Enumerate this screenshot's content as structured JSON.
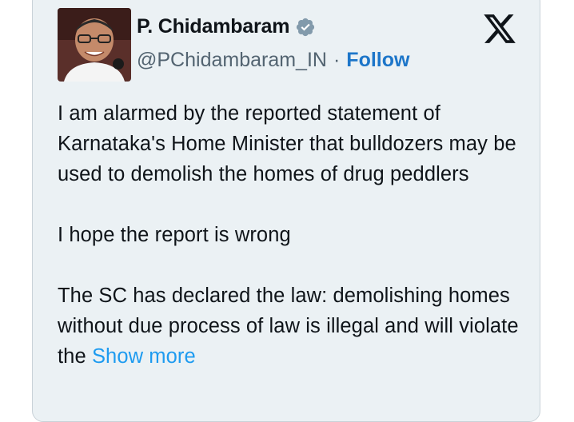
{
  "author": {
    "name": "P. Chidambaram",
    "handle": "@PChidambaram_IN",
    "separator": "·",
    "follow_label": "Follow"
  },
  "tweet": {
    "paragraphs": [
      "I am alarmed by the reported statement of Karnataka's Home Minister that bulldozers may be used to demolish the homes of drug peddlers",
      "I hope the report is wrong"
    ],
    "last_paragraph": "The SC has declared the law: demolishing homes without due process of law is illegal and will violate the",
    "show_more_label": "Show more"
  },
  "colors": {
    "card_background": "#ebf1f4",
    "follow_blue": "#1d76c9",
    "show_more_blue": "#1d9bf0",
    "verified_badge": "#829aab"
  },
  "icons": {
    "verified": "verified-badge-icon",
    "brand": "x-logo-icon"
  }
}
